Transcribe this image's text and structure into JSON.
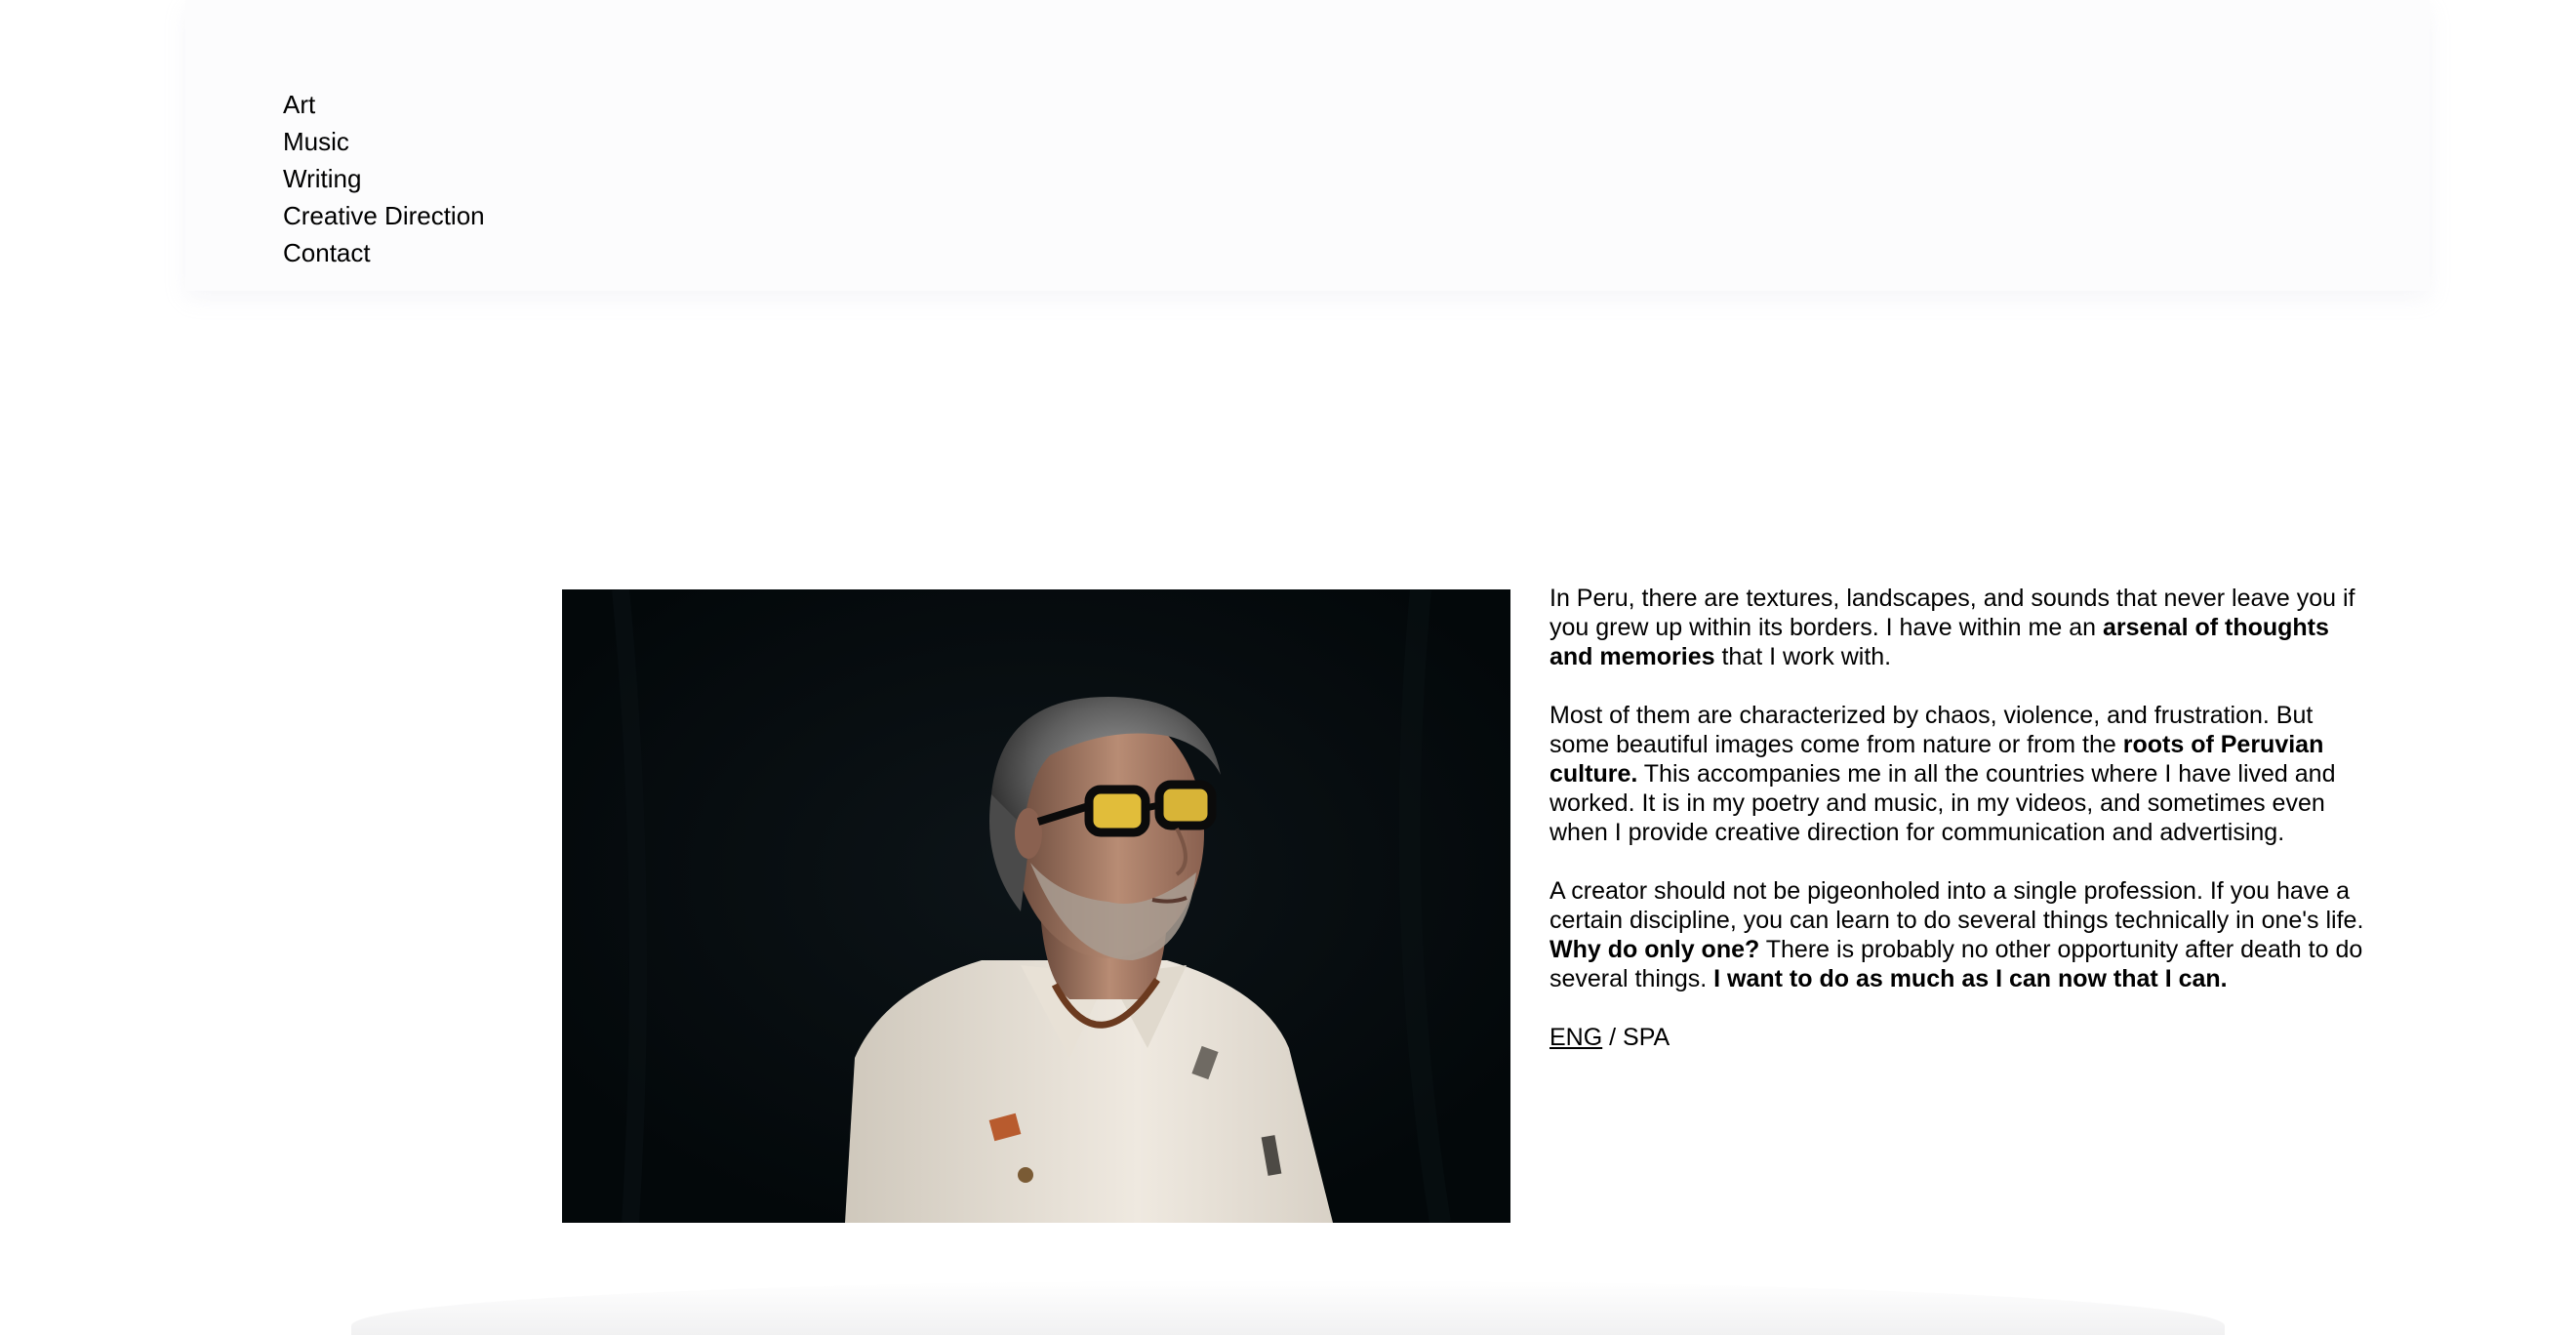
{
  "nav": {
    "items": [
      {
        "label": "Art"
      },
      {
        "label": "Music"
      },
      {
        "label": "Writing"
      },
      {
        "label": "Creative Direction"
      },
      {
        "label": "Contact"
      }
    ]
  },
  "bio": {
    "p1": {
      "a": "In Peru, there are textures, landscapes, and sounds that never leave you if you grew up within its borders. I have within me an ",
      "b": "arsenal of thoughts and memories",
      "c": " that I work with."
    },
    "p2": {
      "a": "Most of them are characterized by chaos, violence, and frustration. But some beautiful images come from nature or from the ",
      "b": "roots of Peruvian culture.",
      "c": " This accompanies me in all the countries where I have lived and worked. It is in my poetry and music, in my videos, and sometimes even when I provide creative direction for communication and advertising."
    },
    "p3": {
      "a": "A creator should not be pigeonholed into a single profession. If you have a certain discipline, you can learn to do several things technically in one's life. ",
      "b": "Why do only one?",
      "c": " There is probably no other opportunity after death to do several things. ",
      "d": "I want to do as much as I can now that I can."
    }
  },
  "language": {
    "eng": "ENG",
    "separator": " / ",
    "spa": "SPA",
    "active": "ENG"
  },
  "colors": {
    "photo_background": "#04090b",
    "header_background": "#fcfcfd"
  }
}
